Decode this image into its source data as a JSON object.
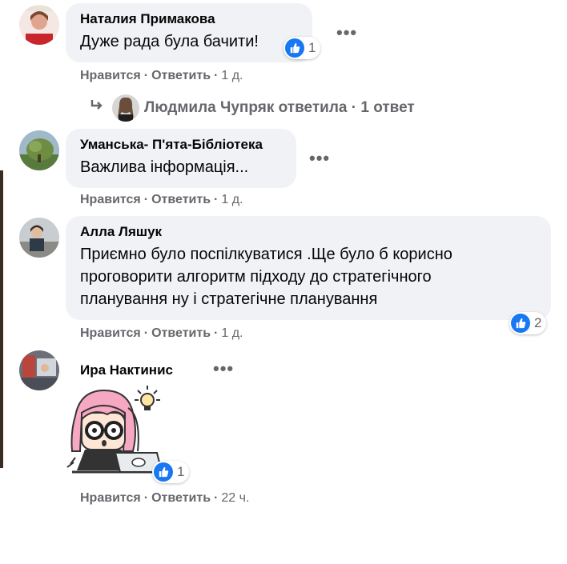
{
  "comments": [
    {
      "author": "Наталия Примакова",
      "text": "Дуже рада була бачити!",
      "reaction_count": "1",
      "like": "Нравится",
      "reply": "Ответить",
      "time": "1 д."
    },
    {
      "author": "Уманська- П'ята-Бібліотека",
      "text": "Важлива інформація...",
      "like": "Нравится",
      "reply": "Ответить",
      "time": "1 д."
    },
    {
      "author": "Алла Ляшук",
      "text_lines": [
        "Приємно було поспілкуватися .Ще було б корисно",
        "проговорити алгоритм підходу до стратегічного",
        "планування ну і стратегічне планування"
      ],
      "reaction_count": "2",
      "like": "Нравится",
      "reply": "Ответить",
      "time": "1 д."
    },
    {
      "author": "Ира Нактинис",
      "reaction_count": "1",
      "like": "Нравится",
      "reply": "Ответить",
      "time": "22 ч."
    }
  ],
  "reply_thread": {
    "author": "Людмила Чупряк",
    "action": "ответила",
    "count": "1 ответ"
  },
  "colors": {
    "bubble": "#f0f2f5",
    "like_blue": "#1877f2",
    "meta_gray": "#65676b"
  },
  "icons": [
    "more-dots-icon",
    "like-thumb-icon",
    "reply-arrow-icon"
  ]
}
